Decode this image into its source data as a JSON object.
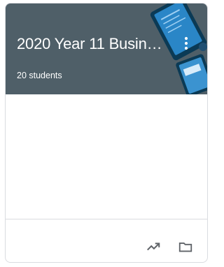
{
  "course_card": {
    "title": "2020 Year 11 Busines...",
    "students": "20 students",
    "banner_color": "#4f5f68"
  },
  "icons": {
    "more": "more-vert-icon",
    "gradebook": "trending-up-icon",
    "folder": "folder-icon"
  }
}
